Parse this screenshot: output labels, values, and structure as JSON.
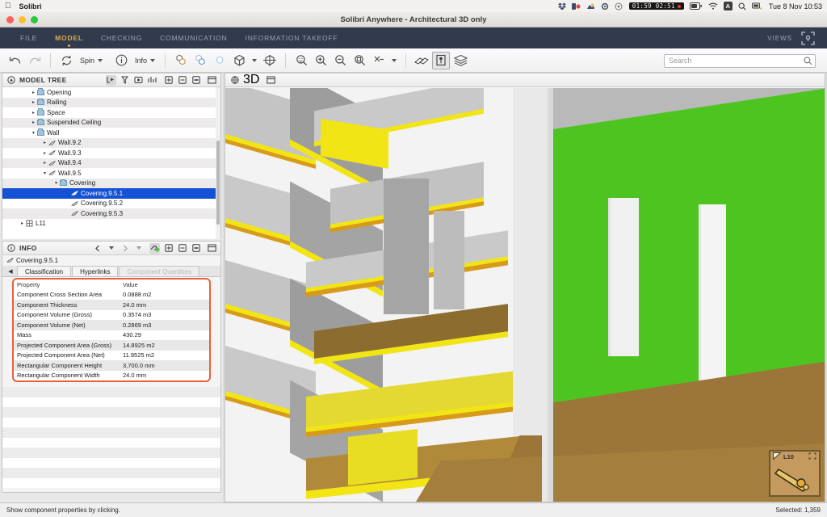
{
  "os_menubar": {
    "apple_icon": "apple-logo-icon",
    "app_name": "Solibri",
    "status_icons": [
      "dropbox-icon",
      "clock-record-icon",
      "cloud-sync-icon",
      "settings-gear-icon",
      "circle-record-icon"
    ],
    "timer_value": "01:59 02:51",
    "battery_icon": "battery-icon",
    "wifi_icon": "wifi-icon",
    "input_source": "A",
    "search_icon": "spotlight-search-icon",
    "control_center_icon": "control-center-icon",
    "clock": "Tue 8 Nov  10:53"
  },
  "window": {
    "title": "Solibri Anywhere - Architectural 3D only",
    "close_label": "close-button",
    "minimize_label": "minimize-button",
    "zoom_label": "zoom-button"
  },
  "menubar": {
    "items": [
      {
        "label": "FILE",
        "active": false
      },
      {
        "label": "MODEL",
        "active": true
      },
      {
        "label": "CHECKING",
        "active": false
      },
      {
        "label": "COMMUNICATION",
        "active": false
      },
      {
        "label": "INFORMATION TAKEOFF",
        "active": false
      }
    ],
    "views_label": "VIEWS",
    "views_icon": "views-layout-icon",
    "accent_color": "#d8ae4e",
    "background_color": "#323a4e"
  },
  "toolbar": {
    "undo": "undo-icon",
    "redo": "redo-icon",
    "spin_label": "Spin",
    "spin_icon": "spin-rotate-icon",
    "info_label": "Info",
    "info_icon": "info-circle-icon",
    "buttons": [
      "show-hidden-components-icon",
      "transparent-components-icon",
      "hide-components-icon",
      "cube-view-icon",
      "section-box-icon",
      "zoom-fit-icon",
      "zoom-in-icon",
      "zoom-out-icon",
      "zoom-selected-icon",
      "pick-tool-icon",
      "measure-icon",
      "markup-icon",
      "layers-icon"
    ]
  },
  "search": {
    "placeholder": "Search",
    "value": "",
    "icon": "search-icon"
  },
  "model_tree": {
    "title": "MODEL TREE",
    "title_icon": "model-tree-icon",
    "header_icons": [
      "select-node-icon",
      "tree-filter-icon",
      "tree-group-icon",
      "tree-settings-icon",
      "expand-all-icon",
      "collapse-all-icon",
      "collapse-selected-icon",
      "split-panel-icon"
    ],
    "rows": [
      {
        "label": "Opening",
        "indent": 3,
        "icon": "folder-icon",
        "twist": "▸",
        "selected": false
      },
      {
        "label": "Railing",
        "indent": 3,
        "icon": "folder-icon",
        "twist": "▸",
        "selected": false
      },
      {
        "label": "Space",
        "indent": 3,
        "icon": "folder-icon",
        "twist": "▸",
        "selected": false
      },
      {
        "label": "Suspended Ceiling",
        "indent": 3,
        "icon": "folder-icon",
        "twist": "▸",
        "selected": false
      },
      {
        "label": "Wall",
        "indent": 3,
        "icon": "folder-icon",
        "twist": "▾",
        "selected": false
      },
      {
        "label": "Wall.9.2",
        "indent": 4,
        "icon": "component-icon",
        "twist": "▸",
        "selected": false
      },
      {
        "label": "Wall.9.3",
        "indent": 4,
        "icon": "component-icon",
        "twist": "▸",
        "selected": false
      },
      {
        "label": "Wall.9.4",
        "indent": 4,
        "icon": "component-icon",
        "twist": "▸",
        "selected": false
      },
      {
        "label": "Wall.9.5",
        "indent": 4,
        "icon": "component-icon",
        "twist": "▾",
        "selected": false
      },
      {
        "label": "Covering",
        "indent": 5,
        "icon": "folder-icon",
        "twist": "▾",
        "selected": false
      },
      {
        "label": "Covering.9.5.1",
        "indent": 6,
        "icon": "component-icon",
        "twist": "",
        "selected": true
      },
      {
        "label": "Covering.9.5.2",
        "indent": 6,
        "icon": "component-icon",
        "twist": "",
        "selected": false
      },
      {
        "label": "Covering.9.5.3",
        "indent": 6,
        "icon": "component-icon",
        "twist": "",
        "selected": false
      },
      {
        "label": "L11",
        "indent": 2,
        "icon": "level-icon",
        "twist": "▸",
        "selected": false
      }
    ],
    "selection_color": "#1451d4"
  },
  "info_panel": {
    "title": "INFO",
    "title_icon": "info-circle-icon",
    "nav_icons": [
      "prev-arrow-icon",
      "history-dropdown-icon",
      "next-arrow-icon",
      "forward-dropdown-icon"
    ],
    "header_icons": [
      "link-components-icon",
      "expand-all-icon",
      "collapse-all-icon",
      "collapse-selected-icon",
      "split-panel-icon"
    ],
    "subject": "Covering.9.5.1",
    "subject_icon": "component-icon",
    "tab_scroll_icon": "scroll-left-icon",
    "tabs": [
      {
        "label": "Classification",
        "state": "normal"
      },
      {
        "label": "Hyperlinks",
        "state": "normal"
      },
      {
        "label": "Component Quantities",
        "state": "faded"
      }
    ],
    "table": {
      "columns": [
        "Property",
        "Value"
      ],
      "rows": [
        {
          "property": "Component Cross Section Area",
          "value": "0.0888 m2"
        },
        {
          "property": "Component Thickness",
          "value": "24.0 mm"
        },
        {
          "property": "Component Volume (Gross)",
          "value": "0.3574 m3"
        },
        {
          "property": "Component Volume (Net)",
          "value": "0.2869 m3"
        },
        {
          "property": "Mass",
          "value": "430.29"
        },
        {
          "property": "Projected Component Area (Gross)",
          "value": "14.8925 m2"
        },
        {
          "property": "Projected Component Area (Net)",
          "value": "11.9525 m2"
        },
        {
          "property": "Rectangular Component Height",
          "value": "3,700.0 mm"
        },
        {
          "property": "Rectangular Component Width",
          "value": "24.0 mm"
        }
      ],
      "highlight_color": "#e8603c"
    }
  },
  "view_panel": {
    "title": "3D",
    "title_icon": "globe-3d-icon",
    "maximize_icon": "maximize-panel-icon",
    "scene_colors": {
      "green_wall": "#4ec421",
      "brown_floor": "#9c7538",
      "slab_gray": "#b9b9b9",
      "slab_top": "#d6d6d6",
      "yellow_band": "#f2e515",
      "orange_band": "#d79a1a",
      "background": "#f3f3f3"
    },
    "nav_widget": {
      "label": "L10",
      "corner_icon": "view-corner-icon",
      "expand_icon": "expand-nav-icon"
    }
  },
  "status_bar": {
    "hint": "Show component properties by clicking.",
    "selection": "Selected: 1,359"
  }
}
